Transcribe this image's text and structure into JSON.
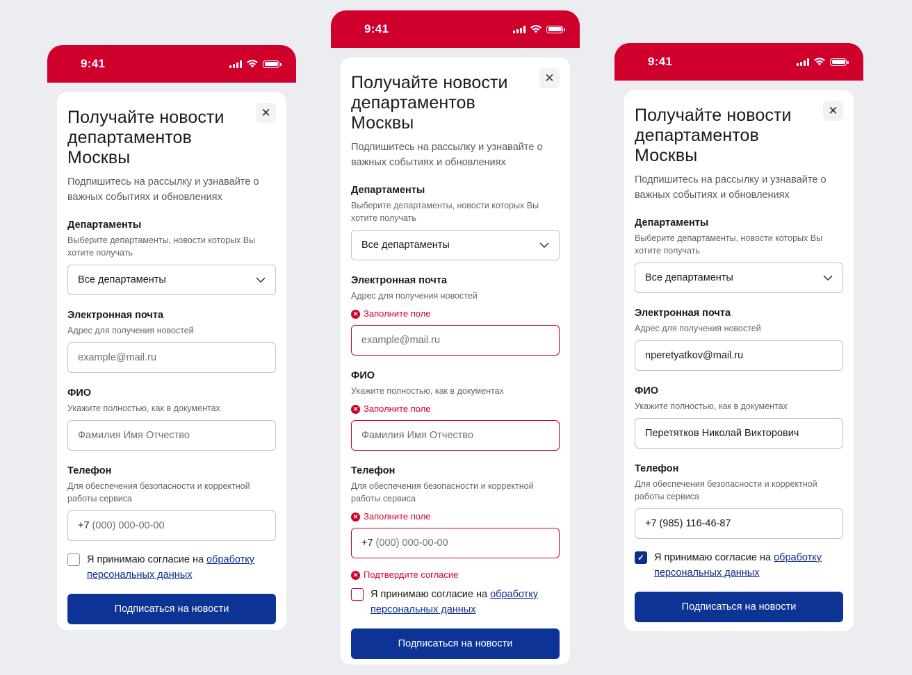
{
  "status": {
    "time": "9:41"
  },
  "form": {
    "title": "Получайте новости департаментов Москвы",
    "subtitle": "Подпишитесь на рассылку и узнавайте о важных событиях и обновлениях",
    "departments": {
      "label": "Департаменты",
      "hint": "Выберите департаменты, новости которых Вы хотите получать",
      "value": "Все департаменты"
    },
    "email": {
      "label": "Электронная почта",
      "hint": "Адрес для получения новостей",
      "placeholder": "example@mail.ru"
    },
    "fio": {
      "label": "ФИО",
      "hint": "Укажите полностью, как в документах",
      "placeholder": "Фамилия Имя Отчество"
    },
    "phone": {
      "label": "Телефон",
      "hint": "Для обеспечения безопасности и корректной работы сервиса",
      "country_code": "+7",
      "placeholder": "(000) 000-00-00"
    },
    "consent_text": "Я принимаю согласие на ",
    "consent_link": "обработку персональных данных",
    "submit": "Подписаться на новости",
    "error_required": "Заполните поле",
    "error_consent": "Подтвердите согласие"
  },
  "filled": {
    "email": "nperetyatkov@mail.ru",
    "fio": "Перетятков Николай Викторович",
    "phone": "+7 (985) 116-46-87"
  },
  "colors": {
    "brand_red": "#d0002c",
    "primary_blue": "#0d3494",
    "background": "#ebedf0"
  },
  "icons": [
    "close-icon",
    "chevron-down-icon",
    "error-icon",
    "signal-icon",
    "wifi-icon",
    "battery-icon",
    "check-icon"
  ]
}
